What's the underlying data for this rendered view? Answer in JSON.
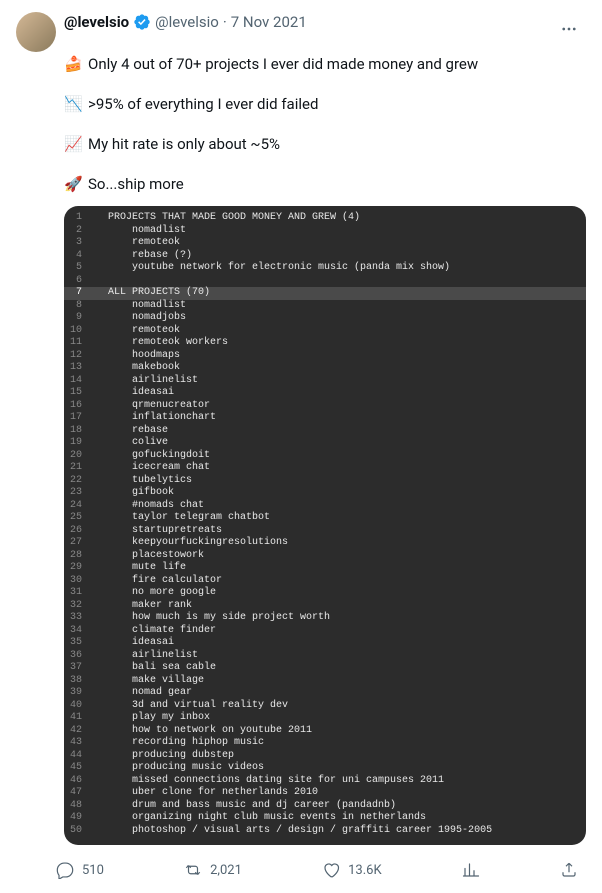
{
  "header": {
    "display_name": "@levelsio",
    "handle": "@levelsio",
    "dot": "·",
    "date": "7 Nov 2021"
  },
  "lines": [
    {
      "emoji": "🍰",
      "text": "Only 4 out of 70+ projects I ever did made money and grew"
    },
    {
      "emoji": "📉",
      "text": ">95% of everything I ever did failed"
    },
    {
      "emoji": "📈",
      "text": "My hit rate is only about ~5%"
    },
    {
      "emoji": "🚀",
      "text": "So...ship more"
    }
  ],
  "code": [
    "   PROJECTS THAT MADE GOOD MONEY AND GREW (4)",
    "       nomadlist",
    "       remoteok",
    "       rebase (?)",
    "       youtube network for electronic music (panda mix show)",
    "",
    "   ALL PROJECTS (70)",
    "       nomadlist",
    "       nomadjobs",
    "       remoteok",
    "       remoteok workers",
    "       hoodmaps",
    "       makebook",
    "       airlinelist",
    "       ideasai",
    "       qrmenucreator",
    "       inflationchart",
    "       rebase",
    "       colive",
    "       gofuckingdoit",
    "       icecream chat",
    "       tubelytics",
    "       gifbook",
    "       #nomads chat",
    "       taylor telegram chatbot",
    "       startupretreats",
    "       keepyourfuckingresolutions",
    "       placestowork",
    "       mute life",
    "       fire calculator",
    "       no more google",
    "       maker rank",
    "       how much is my side project worth",
    "       climate finder",
    "       ideasai",
    "       airlinelist",
    "       bali sea cable",
    "       make village",
    "       nomad gear",
    "       3d and virtual reality dev",
    "       play my inbox",
    "       how to network on youtube 2011",
    "       recording hiphop music",
    "       producing dubstep",
    "       producing music videos",
    "       missed connections dating site for uni campuses 2011",
    "       uber clone for netherlands 2010",
    "       drum and bass music and dj career (pandadnb)",
    "       organizing night club music events in netherlands",
    "       photoshop / visual arts / design / graffiti career 1995-2005"
  ],
  "code_highlight_line": 7,
  "actions": {
    "replies": "510",
    "retweets": "2,021",
    "likes": "13.6K"
  }
}
